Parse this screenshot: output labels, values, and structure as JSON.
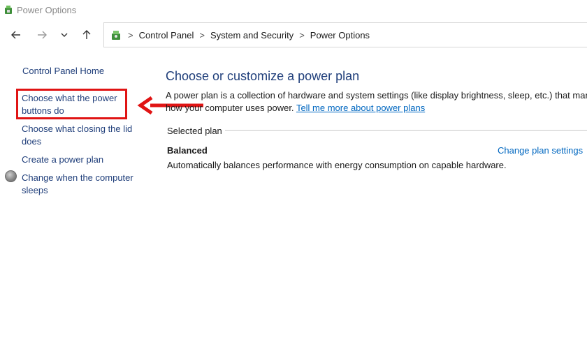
{
  "window": {
    "title": "Power Options"
  },
  "breadcrumb": {
    "items": [
      "Control Panel",
      "System and Security",
      "Power Options"
    ],
    "separator": ">"
  },
  "sidebar": {
    "home": "Control Panel Home",
    "links": [
      "Choose what the power buttons do",
      "Choose what closing the lid does",
      "Create a power plan",
      "Change when the computer sleeps"
    ]
  },
  "main": {
    "title": "Choose or customize a power plan",
    "description_line1": "A power plan is a collection of hardware and system settings (like display brightness, sleep, etc.) that manag",
    "description_line2": "how your computer uses power.",
    "learn_more_link": "Tell me more about power plans",
    "selected_plan_label": "Selected plan",
    "plan": {
      "name": "Balanced",
      "change_settings": "Change plan settings",
      "description": "Automatically balances performance with energy consumption on capable hardware."
    }
  },
  "annotation": {
    "highlight_color": "#e01414"
  },
  "icons": {
    "app": "power-options-icon",
    "back": "arrow-left-icon",
    "forward": "arrow-right-icon",
    "recent": "chevron-down-icon",
    "up": "arrow-up-icon",
    "control_panel": "control-panel-icon",
    "sleep": "shield-icon"
  }
}
